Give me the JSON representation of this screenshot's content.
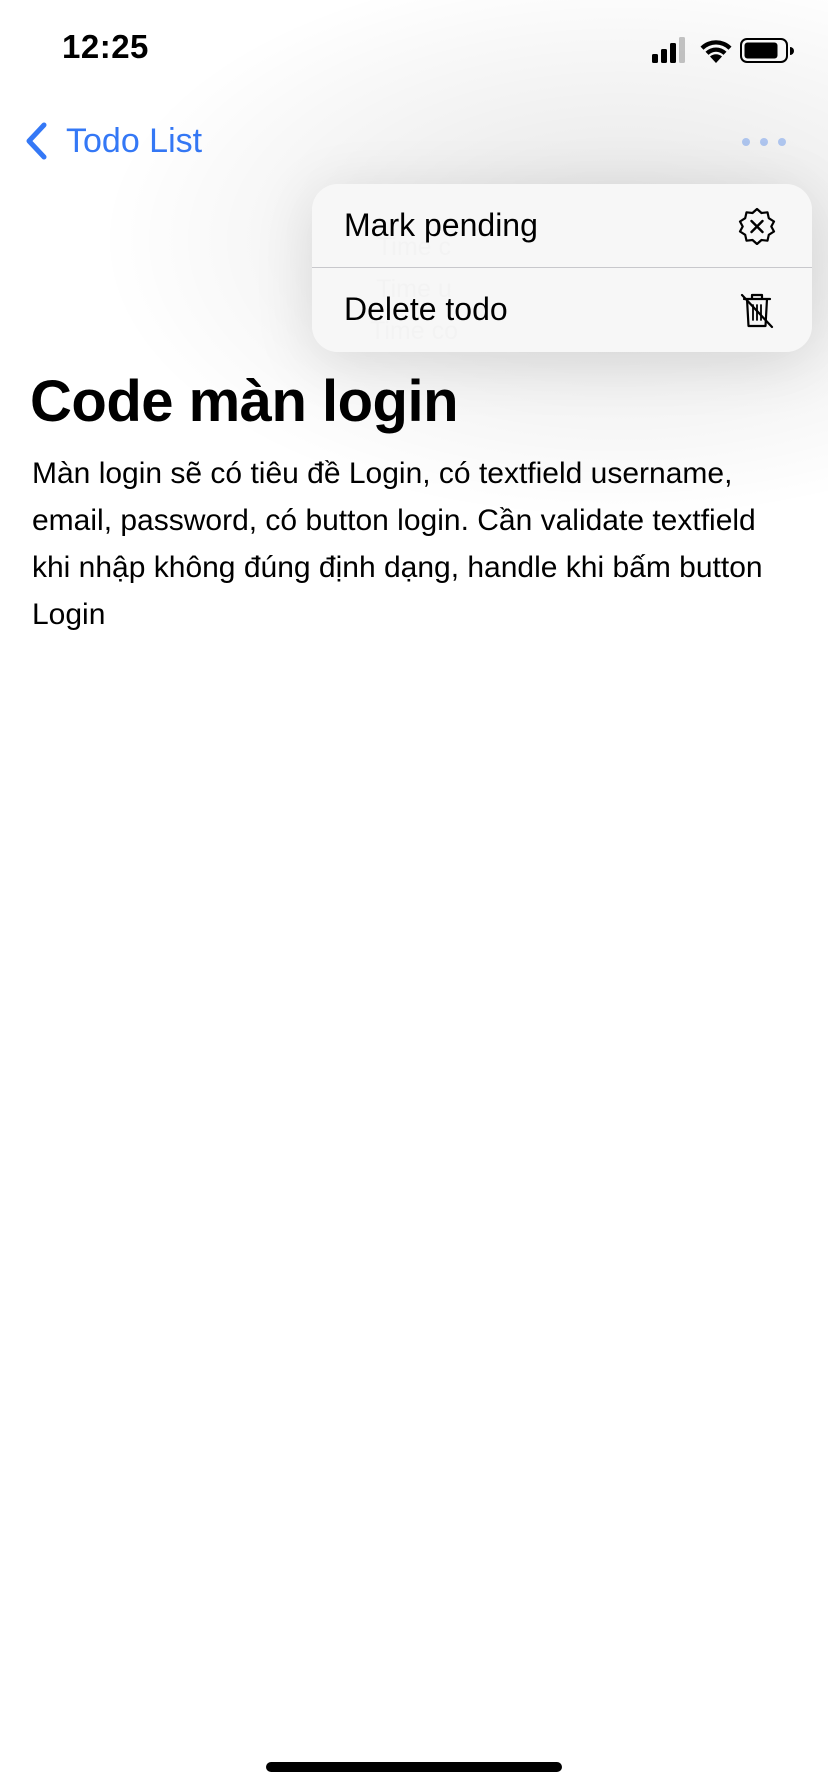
{
  "status_bar": {
    "time": "12:25",
    "icons": [
      "cellular-signal-icon",
      "wifi-icon",
      "battery-icon"
    ]
  },
  "nav": {
    "back_label": "Todo List",
    "more_icon": "ellipsis-icon",
    "accent_color": "#3478f6"
  },
  "todo": {
    "meta": [
      "Time c",
      "Time u",
      "Time co"
    ],
    "title": "Code màn login",
    "description": "Màn login sẽ có tiêu đề Login, có textfield username, email, password, có button login. Cần validate textfield khi nhập không đúng định dạng, handle khi bấm button Login"
  },
  "menu": {
    "items": [
      {
        "label": "Mark pending",
        "icon": "xmark-seal-icon"
      },
      {
        "label": "Delete todo",
        "icon": "trash-slash-icon"
      }
    ]
  }
}
